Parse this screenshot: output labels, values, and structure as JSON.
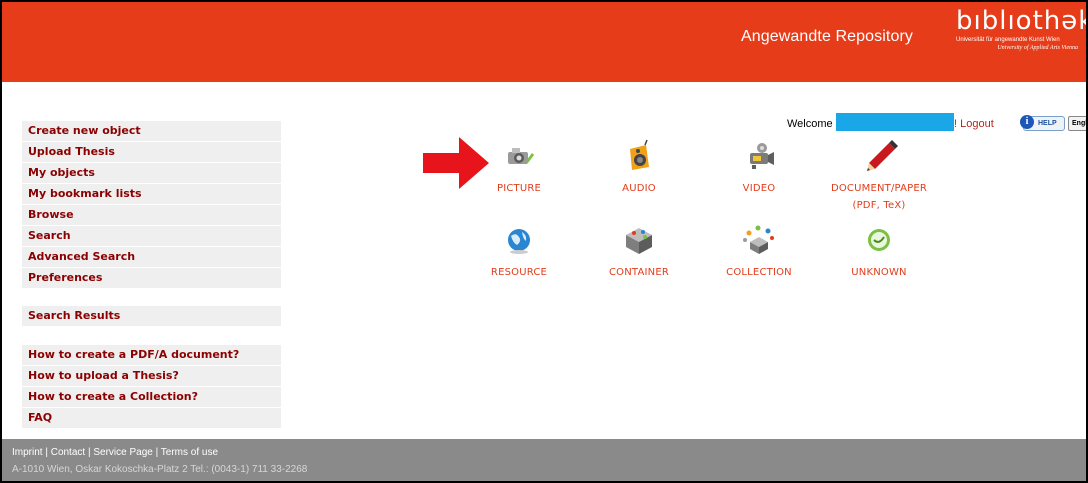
{
  "header": {
    "repo_title": "Angewandte Repository",
    "logo": {
      "word": "bıblıothək",
      "subtitle_line1": "Universität für angewandte Kunst Wien",
      "subtitle_line2": "University of Applied Arts Vienna"
    },
    "brand_color": "#e63c1a"
  },
  "topbar": {
    "welcome_label": "Welcome",
    "logout_label": "! Logout",
    "help_label": "HELP",
    "language_selected": "English"
  },
  "sidebar": {
    "group1": [
      {
        "label": "Create new object"
      },
      {
        "label": "Upload Thesis"
      },
      {
        "label": "My objects"
      },
      {
        "label": "My bookmark lists"
      },
      {
        "label": "Browse"
      },
      {
        "label": "Search"
      },
      {
        "label": "Advanced Search"
      },
      {
        "label": "Preferences"
      }
    ],
    "group2": [
      {
        "label": "Search Results"
      }
    ],
    "group3": [
      {
        "label": "How to create a PDF/A document?"
      },
      {
        "label": "How to upload a Thesis?"
      },
      {
        "label": "How to create a Collection?"
      },
      {
        "label": "FAQ"
      }
    ]
  },
  "object_types": [
    {
      "label": "PICTURE",
      "icon": "camera-icon"
    },
    {
      "label": "AUDIO",
      "icon": "speaker-icon"
    },
    {
      "label": "VIDEO",
      "icon": "film-reel-icon"
    },
    {
      "label": "DOCUMENT/PAPER",
      "sublabel": "(PDF, TeX)",
      "icon": "pencil-icon"
    },
    {
      "label": "RESOURCE",
      "icon": "globe-icon"
    },
    {
      "label": "CONTAINER",
      "icon": "container-icon"
    },
    {
      "label": "COLLECTION",
      "icon": "collection-icon"
    },
    {
      "label": "UNKNOWN",
      "icon": "unknown-icon"
    }
  ],
  "annotation": {
    "icon": "red-arrow-icon",
    "color": "#e8141b"
  },
  "footer": {
    "links": "Imprint | Contact | Service Page | Terms of use",
    "address": "A-1010 Wien, Oskar Kokoschka-Platz 2 Tel.: (0043-1) 711 33-2268"
  }
}
